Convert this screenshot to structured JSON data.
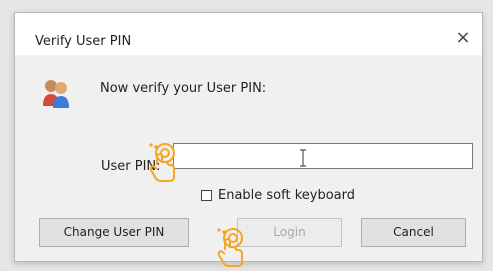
{
  "dialog": {
    "title": "Verify User PIN",
    "close_glyph": "×",
    "prompt": "Now verify your User PIN:",
    "user_icon": "users-icon"
  },
  "form": {
    "pin_label": "User PIN:",
    "pin_value": "",
    "soft_keyboard_label": "Enable soft keyboard",
    "soft_keyboard_checked": false
  },
  "buttons": {
    "change_pin": "Change User PIN",
    "login": "Login",
    "cancel": "Cancel"
  },
  "annotations": {
    "pointer_icon": "hand-pointer-icon",
    "accent_color": "#f5a623"
  }
}
